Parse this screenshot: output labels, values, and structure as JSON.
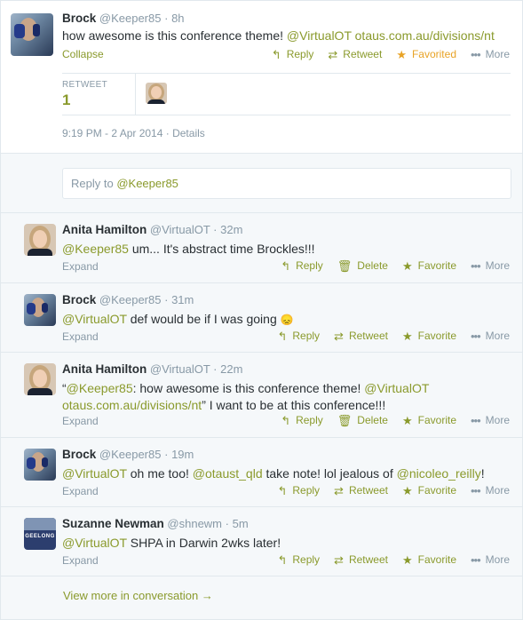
{
  "main_tweet": {
    "name": "Brock",
    "handle": "@Keeper85",
    "time": "8h",
    "text_main": "how awesome is this conference theme!",
    "mention": "@VirtualOT",
    "link": "otaus.com.au/divisions/nt",
    "collapse": "Collapse",
    "actions": {
      "reply": "Reply",
      "retweet": "Retweet",
      "favorite": "Favorited",
      "more": "More"
    },
    "retweet_label": "RETWEET",
    "retweet_count": "1",
    "timestamp": "9:19 PM - 2 Apr 2014",
    "details": "Details"
  },
  "reply_box": {
    "placeholder": "Reply to",
    "mention": "@Keeper85"
  },
  "replies": [
    {
      "name": "Anita Hamilton",
      "handle": "@VirtualOT",
      "time": "32m",
      "mention": "@Keeper85",
      "text": " um... It's abstract time Brockles!!!",
      "expand": "Expand",
      "actions": {
        "reply": "Reply",
        "delete": "Delete",
        "favorite": "Favorite",
        "more": "More"
      }
    },
    {
      "name": "Brock",
      "handle": "@Keeper85",
      "time": "31m",
      "mention": "@VirtualOT",
      "text": " def would be if I was going ",
      "emoji": "😞",
      "expand": "Expand",
      "actions": {
        "reply": "Reply",
        "retweet": "Retweet",
        "favorite": "Favorite",
        "more": "More"
      }
    },
    {
      "name": "Anita Hamilton",
      "handle": "@VirtualOT",
      "time": "22m",
      "quote_open": "“",
      "mention": "@Keeper85",
      "text_a": ": how awesome is this conference theme! ",
      "mention2": "@VirtualOT",
      "link": "otaus.com.au/divisions/nt",
      "text_b": "” I want to be at this conference!!!",
      "expand": "Expand",
      "actions": {
        "reply": "Reply",
        "delete": "Delete",
        "favorite": "Favorite",
        "more": "More"
      }
    },
    {
      "name": "Brock",
      "handle": "@Keeper85",
      "time": "19m",
      "mention": "@VirtualOT",
      "text_a": " oh me too! ",
      "mention2": "@otaust_qld",
      "text_b": " take note! lol jealous of ",
      "mention3": "@nicoleo_reilly",
      "text_c": "!",
      "expand": "Expand",
      "actions": {
        "reply": "Reply",
        "retweet": "Retweet",
        "favorite": "Favorite",
        "more": "More"
      }
    },
    {
      "name": "Suzanne Newman",
      "handle": "@shnewm",
      "time": "5m",
      "mention": "@VirtualOT",
      "text": " SHPA in Darwin 2wks later!",
      "avatar_text": "GEELONG",
      "expand": "Expand",
      "actions": {
        "reply": "Reply",
        "retweet": "Retweet",
        "favorite": "Favorite",
        "more": "More"
      }
    }
  ],
  "view_more": "View more in conversation →",
  "colors": {
    "accent": "#8a9a2c",
    "favorited": "#e8a326",
    "muted": "#8899a6"
  },
  "icons": {
    "reply": "reply-icon",
    "retweet": "retweet-icon",
    "favorite": "star-icon",
    "delete": "trash-icon",
    "more": "more-dots-icon"
  }
}
